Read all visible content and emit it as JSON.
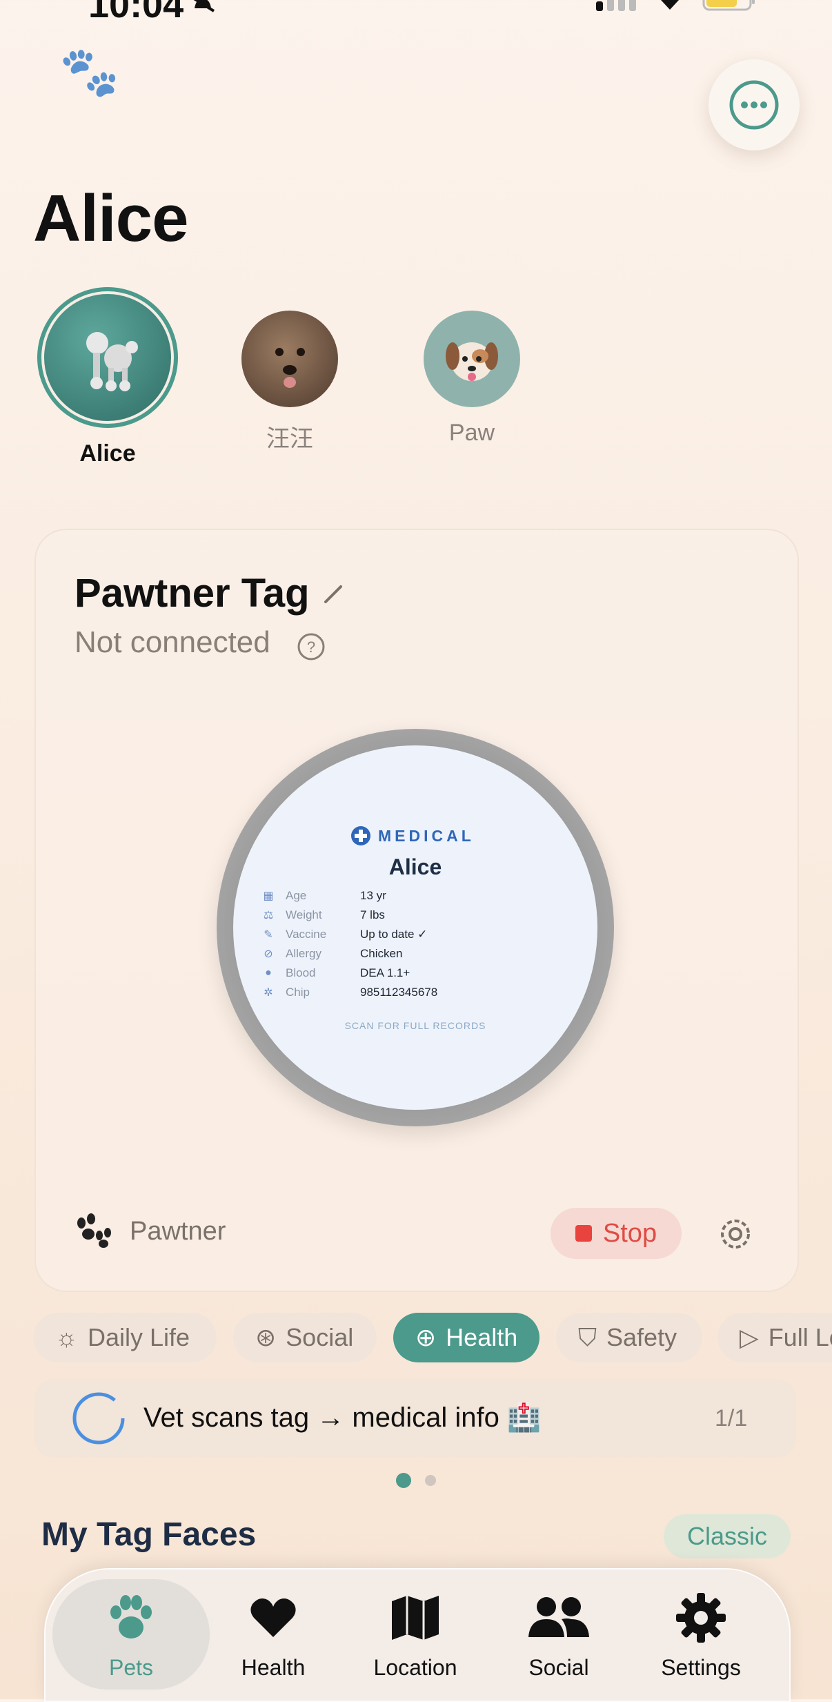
{
  "status_bar": {
    "time": "10:04"
  },
  "header": {
    "title": "Alice"
  },
  "pets": [
    {
      "name": "Alice",
      "selected": true
    },
    {
      "name": "汪汪",
      "selected": false
    },
    {
      "name": "Paw",
      "selected": false
    }
  ],
  "tag_card": {
    "title": "Pawtner Tag",
    "status": "Not connected",
    "brand": "Pawtner",
    "stop_label": "Stop",
    "face": {
      "header": "MEDICAL",
      "name": "Alice",
      "rows": [
        {
          "icon": "calendar-icon",
          "key": "Age",
          "value": "13 yr"
        },
        {
          "icon": "weight-icon",
          "key": "Weight",
          "value": "7 lbs"
        },
        {
          "icon": "syringe-icon",
          "key": "Vaccine",
          "value": "Up to date ✓"
        },
        {
          "icon": "pill-icon",
          "key": "Allergy",
          "value": "Chicken"
        },
        {
          "icon": "drop-icon",
          "key": "Blood",
          "value": "DEA 1.1+"
        },
        {
          "icon": "chip-icon",
          "key": "Chip",
          "value": "985112345678"
        }
      ],
      "footer": "SCAN FOR FULL RECORDS"
    }
  },
  "categories": [
    {
      "label": "Daily Life",
      "icon": "sunrise-icon",
      "active": false
    },
    {
      "label": "Social",
      "icon": "heart-circle-icon",
      "active": false
    },
    {
      "label": "Health",
      "icon": "plus-circle-icon",
      "active": true
    },
    {
      "label": "Safety",
      "icon": "shield-icon",
      "active": false
    },
    {
      "label": "Full Lo",
      "icon": "play-circle-icon",
      "active": false
    }
  ],
  "tip": {
    "text": "Vet scans tag → medical info 🏥",
    "count": "1/1"
  },
  "my_tag_faces": {
    "title": "My Tag Faces",
    "style_label": "Classic"
  },
  "tab_bar": [
    {
      "label": "Pets",
      "icon": "paw-icon",
      "active": true
    },
    {
      "label": "Health",
      "icon": "heart-icon",
      "active": false
    },
    {
      "label": "Location",
      "icon": "map-icon",
      "active": false
    },
    {
      "label": "Social",
      "icon": "people-icon",
      "active": false
    },
    {
      "label": "Settings",
      "icon": "gear-icon",
      "active": false
    }
  ],
  "colors": {
    "accent": "#4b9a8c",
    "stop": "#e8433e",
    "medical": "#2f67b8"
  }
}
